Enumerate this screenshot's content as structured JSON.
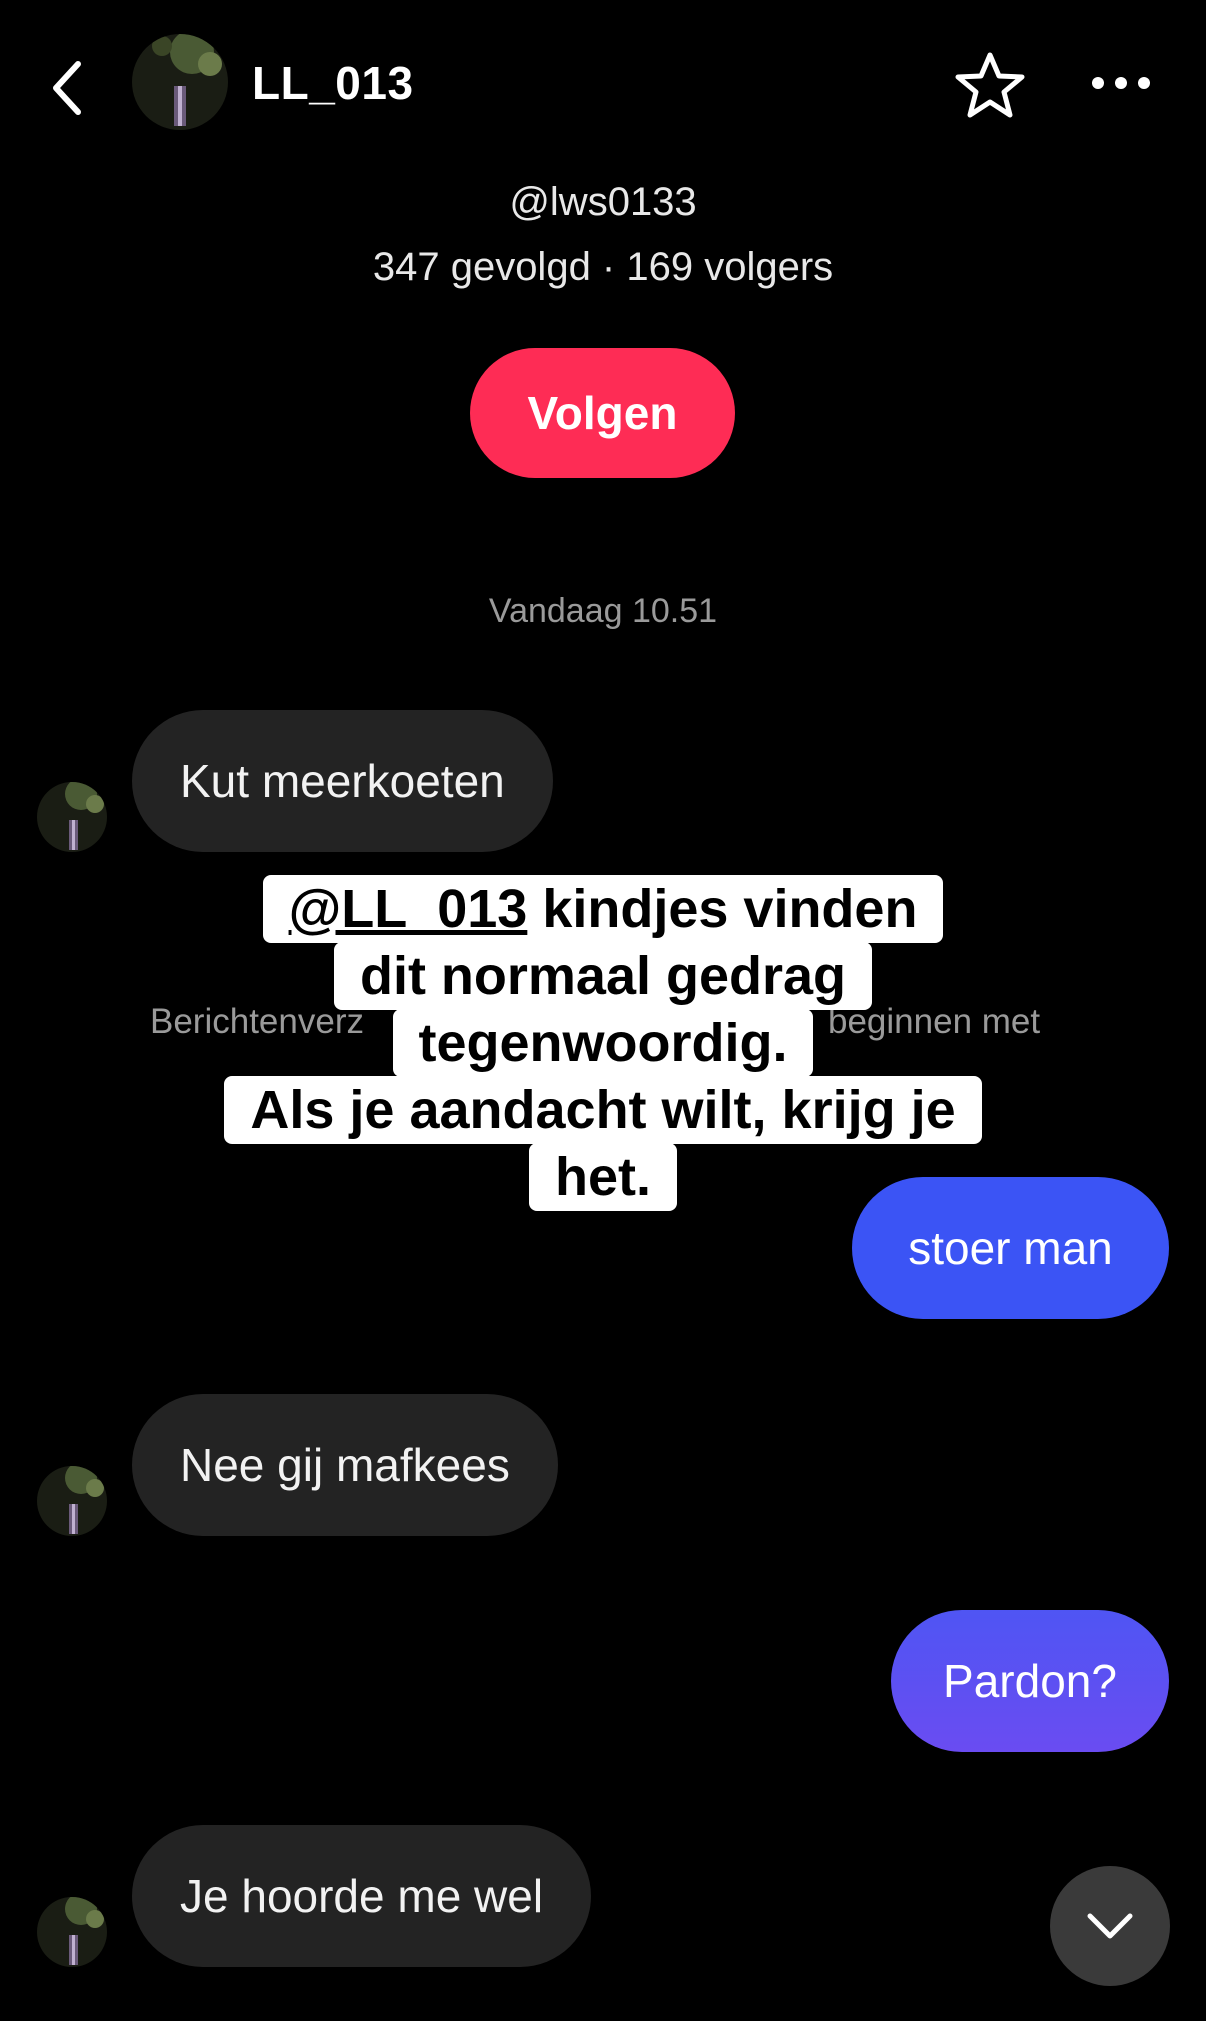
{
  "header": {
    "title": "LL_013",
    "icons": {
      "back": "chevron-left-icon",
      "favorite": "star-icon",
      "more": "more-horizontal-icon"
    }
  },
  "profile": {
    "handle": "@lws0133",
    "stats": "347 gevolgd · 169 volgers",
    "follow_label": "Volgen"
  },
  "chat": {
    "timestamp": "Vandaag 10.51",
    "notice_left": "Berichtenverz",
    "notice_right": "beginnen met",
    "messages": [
      {
        "from": "them",
        "text": "Kut meerkoeten"
      },
      {
        "from": "me",
        "text": "stoer man"
      },
      {
        "from": "them",
        "text": "Nee gij mafkees"
      },
      {
        "from": "me",
        "text": "Pardon?"
      },
      {
        "from": "them",
        "text": "Je hoorde me wel"
      }
    ]
  },
  "caption": {
    "mention": "@LL_013",
    "line1_rest": " kindjes vinden",
    "line2": "dit normaal gedrag",
    "line3": "tegenwoordig.",
    "line4": "Als je aandacht wilt, krijg je",
    "line5": "het."
  },
  "colors": {
    "background": "#000000",
    "follow_button": "#fe2c55",
    "incoming_bubble": "#232323",
    "outgoing_bubble_top": "#3b54f5",
    "outgoing_bubble_bottom": "#6a4cf2"
  },
  "scroll_button_icon": "chevron-down-icon"
}
